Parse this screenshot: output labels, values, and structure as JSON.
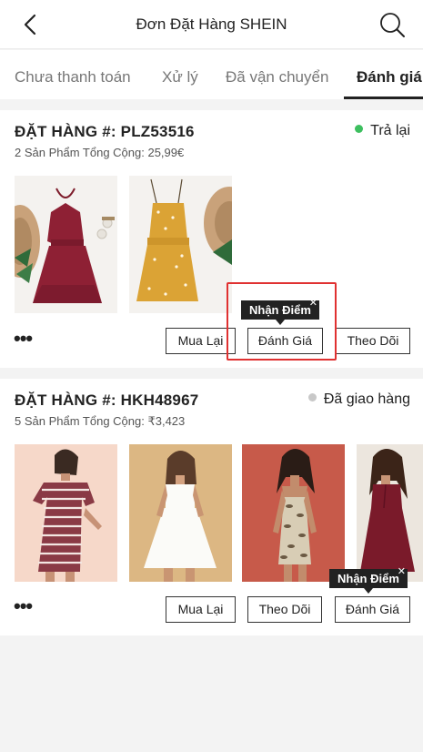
{
  "header": {
    "title": "Đơn Đặt Hàng SHEIN",
    "back_icon": "chevron-left-icon",
    "search_icon": "search-icon"
  },
  "tabs": [
    {
      "label": "Chưa thanh toán",
      "active": false
    },
    {
      "label": "Xử lý",
      "active": false
    },
    {
      "label": "Đã vận chuyển",
      "active": false
    },
    {
      "label": "Đánh giá",
      "active": true
    }
  ],
  "orders": [
    {
      "order_no": "ĐẶT HÀNG #: PLZ53516",
      "summary": "2 Sản Phẩm Tổng Cộng: 25,99€",
      "status": "Trả lại",
      "status_color": "#3dbf5f",
      "products": [
        "burgundy halter dress",
        "mustard floral dress"
      ],
      "tooltip": "Nhận Điểm",
      "buttons": {
        "rebuy": "Mua Lại",
        "review": "Đánh Giá",
        "track": "Theo Dõi"
      }
    },
    {
      "order_no": "ĐẶT HÀNG #: HKH48967",
      "summary": "5 Sản Phẩm Tổng Cộng: ₹3,423",
      "status": "Đã giao hàng",
      "status_color": "#c8c8c8",
      "products": [
        "striped t-shirt dress",
        "white skater dress",
        "snakeskin bandeau dress",
        "burgundy wrap dress"
      ],
      "tooltip": "Nhận Điểm",
      "buttons": {
        "rebuy": "Mua Lại",
        "track": "Theo Dõi",
        "review": "Đánh Giá"
      }
    }
  ],
  "more_icon": "ellipsis-icon",
  "close_icon": "close-icon"
}
